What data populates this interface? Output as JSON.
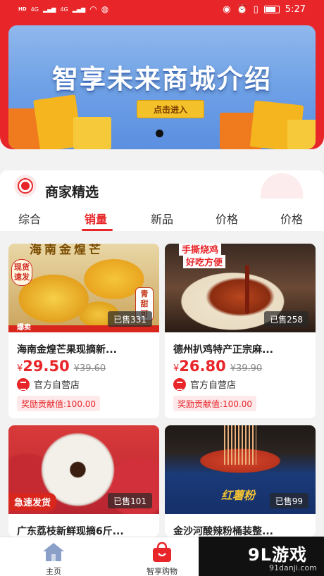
{
  "status_bar": {
    "network_left": "HD",
    "signal_4g_1": "4G",
    "signal_4g_2": "4G",
    "time": "5:27"
  },
  "banner": {
    "title": "智享未来商城介绍",
    "button_label": "点击进入"
  },
  "section": {
    "title": "商家精选"
  },
  "tabs": [
    {
      "label": "综合"
    },
    {
      "label": "销量"
    },
    {
      "label": "新品"
    },
    {
      "label": "价格"
    },
    {
      "label": "价格"
    }
  ],
  "products": [
    {
      "name": "海南金煌芒果现摘新...",
      "currency": "¥",
      "price": "29.50",
      "old_price": "¥39.60",
      "sold": "已售331",
      "shop": "官方自营店",
      "reward": "奖励贡献值:100.00",
      "tag_left": "现货速发",
      "tag_bottom": "爆卖",
      "tag_top": "海南金煌芒",
      "tag_right": "青甜可"
    },
    {
      "name": "德州扒鸡特产正宗麻...",
      "currency": "¥",
      "price": "26.80",
      "old_price": "¥39.90",
      "sold": "已售258",
      "shop": "官方自营店",
      "reward": "奖励贡献值:100.00",
      "tag_top": "手撕烧鸡",
      "tag_top2": "好吃方便"
    },
    {
      "name": "广东荔枝新鲜现摘6斤...",
      "sold": "已售101",
      "tag_bottom": "急速发货"
    },
    {
      "name": "金沙河酸辣粉桶装整...",
      "sold": "已售99",
      "tag_bowl": "红薯粉"
    }
  ],
  "bottom_nav": {
    "home_label": "主页",
    "shop_label": "智享购物"
  },
  "watermark": {
    "logo": "9L游戏",
    "url": "91danji.com"
  },
  "colors": {
    "brand_red": "#e8262a",
    "banner_blue": "#6c9fe6",
    "button_yellow": "#f3c22a"
  }
}
